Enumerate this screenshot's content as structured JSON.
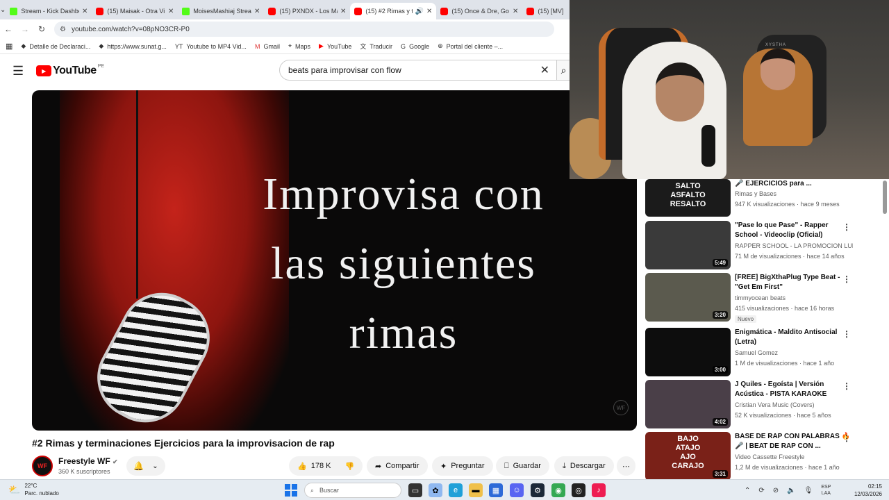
{
  "browser": {
    "tabs": [
      {
        "label": "Stream - Kick Dashbo",
        "icon": "kick-icon",
        "active": false
      },
      {
        "label": "(15) Maisak - Otra Vi",
        "icon": "youtube-icon",
        "active": false
      },
      {
        "label": "MoisesMashiaj Strean",
        "icon": "kick-icon",
        "active": false
      },
      {
        "label": "(15) PXNDX - Los Ma",
        "icon": "youtube-icon",
        "active": false
      },
      {
        "label": "(15) #2 Rimas y t",
        "icon": "youtube-icon",
        "active": true
      },
      {
        "label": "(15) Once & Dre, Go",
        "icon": "youtube-icon",
        "active": false
      },
      {
        "label": "(15) [MV]",
        "icon": "youtube-icon",
        "active": false
      }
    ],
    "url": "youtube.com/watch?v=08pNO3CR-P0",
    "bookmarks": [
      {
        "label": "Detalle de Declaraci...",
        "icon": "sunat-icon"
      },
      {
        "label": "https://www.sunat.g...",
        "icon": "sunat-icon"
      },
      {
        "label": "Youtube to MP4 Vid...",
        "icon": "yt-tool-icon"
      },
      {
        "label": "Gmail",
        "icon": "gmail-icon"
      },
      {
        "label": "Maps",
        "icon": "maps-icon"
      },
      {
        "label": "YouTube",
        "icon": "youtube-icon"
      },
      {
        "label": "Traducir",
        "icon": "translate-icon"
      },
      {
        "label": "Google",
        "icon": "google-icon"
      },
      {
        "label": "Portal del cliente –...",
        "icon": "globe-icon"
      }
    ]
  },
  "youtube": {
    "logo_text": "YouTube",
    "country_code": "PE",
    "search_query": "beats para improvisar con flow",
    "video": {
      "overlay_text": [
        "Improvisa con",
        "las siguientes",
        "rimas"
      ],
      "watermark": "WF",
      "title": "#2 Rimas y terminaciones Ejercicios para la improvisacion de rap",
      "channel": "Freestyle WF",
      "avatar_text": "WF",
      "subscribers": "360 K suscriptores",
      "likes": "178 K",
      "actions": {
        "share": "Compartir",
        "ask": "Preguntar",
        "save": "Guardar",
        "download": "Descargar"
      }
    },
    "related": [
      {
        "title": "🎤 EJERCICIOS para ...",
        "channel": "Rimas y Bases",
        "meta": "947 K visualizaciones · hace 9 meses",
        "duration": "",
        "thumb_text": "SALTO\nASFALTO\nRESALTO",
        "thumb_color": "#1b1b1b",
        "badge": ""
      },
      {
        "title": "\"Pase lo que Pase\" - Rapper School - Videoclip (Oficial)",
        "channel": "RAPPER SCHOOL - LA PROMOCION LUN...",
        "meta": "71 M de visualizaciones · hace 14 años",
        "duration": "5:49",
        "thumb_text": "",
        "thumb_color": "#3a3a3a",
        "badge": ""
      },
      {
        "title": "[FREE] BigXthaPlug Type Beat - \"Get Em First\"",
        "channel": "timmyocean beats",
        "meta": "415 visualizaciones · hace 16 horas",
        "duration": "3:20",
        "thumb_text": "",
        "thumb_color": "#5b5a4e",
        "badge": "Nuevo"
      },
      {
        "title": "Enigmática - Maldito Antisocial (Letra)",
        "channel": "Samuel Gomez",
        "meta": "1 M de visualizaciones · hace 1 año",
        "duration": "3:00",
        "thumb_text": "",
        "thumb_color": "#0d0d0d",
        "badge": ""
      },
      {
        "title": "J Quiles - Egoísta | Versión Acústica - PISTA KARAOKE",
        "channel": "Cristian Vera Music (Covers)",
        "meta": "52 K visualizaciones · hace 5 años",
        "duration": "4:02",
        "thumb_text": "",
        "thumb_color": "#4a3f48",
        "badge": ""
      },
      {
        "title": "BASE DE RAP CON PALABRAS 🔥🎤 | BEAT DE RAP CON ...",
        "channel": "Video Cassette Freestyle",
        "meta": "1,2 M de visualizaciones · hace 1 año",
        "duration": "3:31",
        "thumb_text": "BAJO\nATAJO\nAJO\nCARAJO",
        "thumb_color": "#7a2118",
        "badge": ""
      }
    ]
  },
  "webcam": {
    "chair_brand": "XYSTHA"
  },
  "taskbar": {
    "temperature": "22°C",
    "weather": "Parc. nublado",
    "search_label": "Buscar",
    "language": "ESP",
    "layout": "LAA",
    "time": "02:15",
    "date": "12/03/2026"
  },
  "colors": {
    "accent": "#ff0000",
    "text": "#0f0f0f",
    "muted": "#606060",
    "taskbar": "#e6ecf2"
  }
}
